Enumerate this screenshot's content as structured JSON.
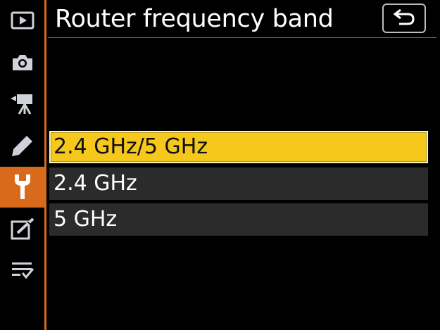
{
  "header": {
    "title": "Router frequency band",
    "back_icon": "return-arrow-icon"
  },
  "sidebar": {
    "items": [
      {
        "icon": "playback-icon",
        "active": false
      },
      {
        "icon": "camera-icon",
        "active": false
      },
      {
        "icon": "movie-camera-icon",
        "active": false
      },
      {
        "icon": "pencil-icon",
        "active": false
      },
      {
        "icon": "wrench-icon",
        "active": true
      },
      {
        "icon": "retouch-icon",
        "active": false
      },
      {
        "icon": "my-menu-icon",
        "active": false
      }
    ]
  },
  "options": [
    {
      "label": "2.4 GHz/5 GHz",
      "selected": true
    },
    {
      "label": "2.4 GHz",
      "selected": false
    },
    {
      "label": "5 GHz",
      "selected": false
    }
  ],
  "colors": {
    "accent": "#d96a1c",
    "selection": "#f7c81c",
    "row_background": "#2b2b2b"
  }
}
